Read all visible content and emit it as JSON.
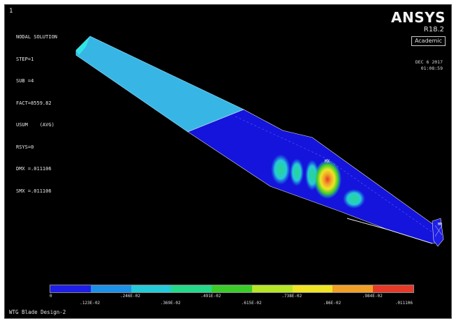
{
  "window": {
    "number": "1"
  },
  "info": {
    "lines": [
      "NODAL SOLUTION",
      "STEP=1",
      "SUB =4",
      "FACT=8559.82",
      "USUM    (AVG)",
      "RSYS=0",
      "DMX =.011106",
      "SMX =.011106"
    ]
  },
  "branding": {
    "logo": "ANSYS",
    "version": "R18.2",
    "license": "Academic",
    "date": "DEC  6 2017",
    "time": "01:08:59"
  },
  "legend": {
    "colors": [
      "#1e1ee6",
      "#1e90e6",
      "#26c9d8",
      "#26d88a",
      "#3ccc2a",
      "#b6e628",
      "#f0e426",
      "#f0a028",
      "#e63a28"
    ],
    "top_labels": [
      "0",
      ".246E-02",
      ".491E-02",
      ".738E-02",
      ".984E-02"
    ],
    "bottom_labels": [
      ".123E-02",
      ".369E-02",
      ".615E-02",
      ".86E-02",
      ".011106"
    ]
  },
  "model": {
    "title": "WTG Blade Design-2",
    "max_marker": "MX",
    "min_marker": "MN",
    "colors": {
      "root": "#37b6e6",
      "blade": "#1414dc",
      "edge": "#e8e8e8"
    }
  }
}
